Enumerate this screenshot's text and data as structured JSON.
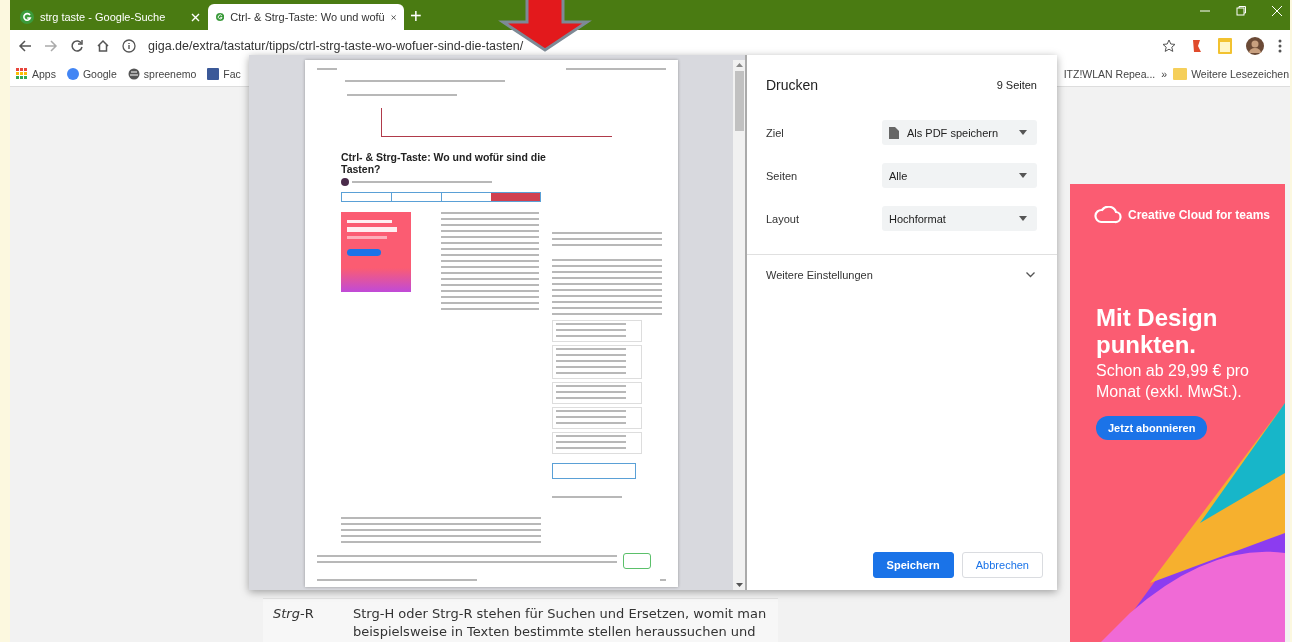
{
  "browser": {
    "tabs": [
      {
        "title": "strg taste - Google-Suche",
        "selected": false
      },
      {
        "title": "Ctrl- & Strg-Taste: Wo und wofü",
        "selected": true
      }
    ],
    "new_tab": "+",
    "address": "giga.de/extra/tastatur/tipps/ctrl-strg-taste-wo-wofuer-sind-die-tasten/",
    "bookmarks": [
      "Apps",
      "Google",
      "spreenemo",
      "Fac"
    ],
    "bookmarks_right": [
      "ITZ!WLAN Repea...",
      "»",
      "Weitere Lesezeichen"
    ]
  },
  "page": {
    "table_rows": [
      {
        "key": "*Strg*-R",
        "text": "Strg-H oder Strg-R stehen für Suchen und Ersetzen, womit man beispielsweise in Texten bestimmte stellen heraussuchen und"
      }
    ],
    "ad": {
      "brand": "Creative Cloud for teams",
      "headline": "Mit Design punkten.",
      "price": "Schon ab 29,99 € pro Monat (exkl. MwSt.).",
      "cta": "Jetzt abonnieren"
    }
  },
  "preview": {
    "heading": "Ctrl- & Strg-Taste: Wo und wofür sind die Tasten?"
  },
  "print_panel": {
    "title": "Drucken",
    "pages": "9 Seiten",
    "settings": [
      {
        "label": "Ziel",
        "value": "Als PDF speichern",
        "kind": "file"
      },
      {
        "label": "Seiten",
        "value": "Alle",
        "kind": "plain"
      },
      {
        "label": "Layout",
        "value": "Hochformat",
        "kind": "plain"
      }
    ],
    "more": "Weitere Einstellungen",
    "buttons": [
      {
        "label": "Speichern",
        "primary": true
      },
      {
        "label": "Abbrechen",
        "primary": false
      }
    ]
  }
}
